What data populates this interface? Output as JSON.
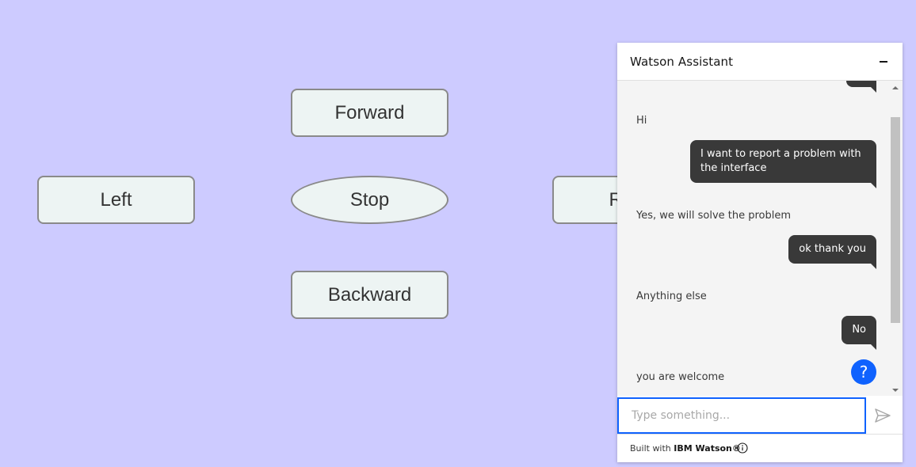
{
  "controls": {
    "forward": "Forward",
    "left": "Left",
    "stop": "Stop",
    "right": "Right",
    "backward": "Backward"
  },
  "chat": {
    "title": "Watson Assistant",
    "messages": [
      {
        "from": "bot",
        "text": "Hi"
      },
      {
        "from": "user",
        "text": "I want to report a problem with the interface"
      },
      {
        "from": "bot",
        "text": "Yes, we will solve the problem"
      },
      {
        "from": "user",
        "text": "ok thank you"
      },
      {
        "from": "bot",
        "text": "Anything else"
      },
      {
        "from": "user",
        "text": "No"
      },
      {
        "from": "bot",
        "text": "you are welcome"
      }
    ],
    "help_symbol": "?",
    "input_placeholder": "Type something...",
    "footer_prefix": "Built with",
    "footer_brand": "IBM Watson®"
  },
  "colors": {
    "background": "#cdcbff",
    "button_fill": "#edf4f3",
    "user_bubble": "#393939",
    "accent": "#0f62fe"
  },
  "icons": {
    "minimize": "minimize-icon",
    "help": "help-icon",
    "send": "send-icon",
    "info": "info-icon",
    "scroll_up": "scroll-up-icon",
    "scroll_down": "scroll-down-icon"
  }
}
